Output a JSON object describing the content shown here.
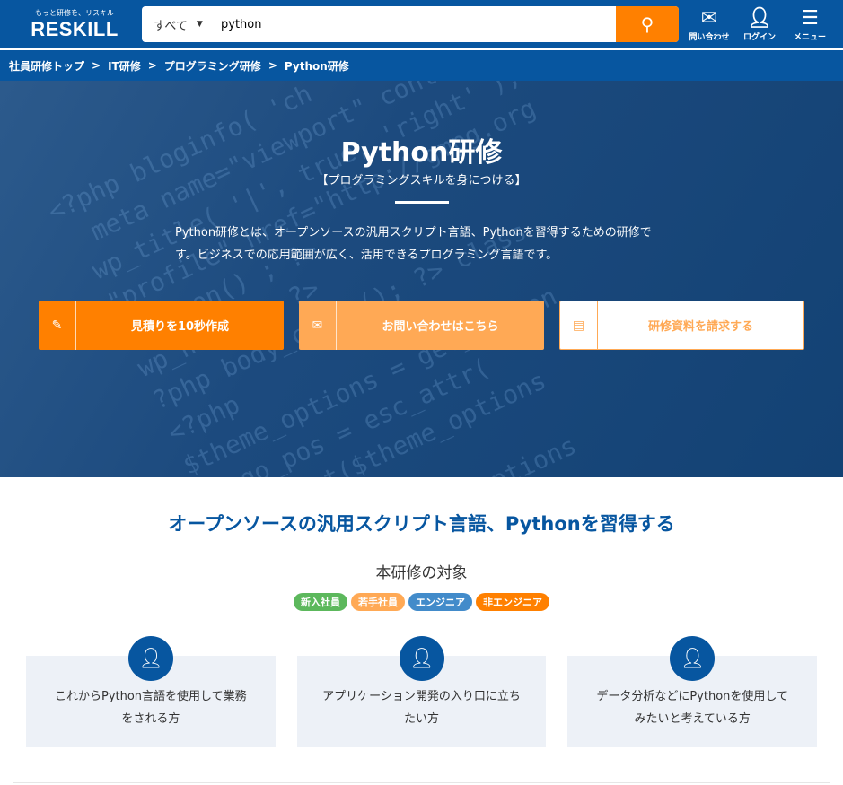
{
  "header": {
    "tagline": "もっと研修を、リスキル",
    "logo": "RESKILL",
    "search_category": "すべて",
    "search_value": "python",
    "icons": [
      {
        "icon": "mail-icon",
        "label": "問い合わせ"
      },
      {
        "icon": "user-icon",
        "label": "ログイン"
      },
      {
        "icon": "menu-icon",
        "label": "メニュー"
      }
    ]
  },
  "breadcrumb": [
    "社員研修トップ",
    "IT研修",
    "プログラミング研修",
    "Python研修"
  ],
  "hero": {
    "title": "Python研修",
    "subtitle": "【プログラミングスキルを身につける】",
    "description": "Python研修とは、オープンソースの汎用スクリプト言語、Pythonを習得するための研修です。ビジネスでの応用範囲が広く、活用できるプログラミング言語です。",
    "buttons": [
      "見積りを10秒作成",
      "お問い合わせはこちら",
      "研修資料を請求する"
    ]
  },
  "main": {
    "heading": "オープンソースの汎用スクリプト言語、Pythonを習得する",
    "target_title": "本研修の対象",
    "badges": [
      {
        "label": "新入社員",
        "color": "#5cb85c"
      },
      {
        "label": "若手社員",
        "color": "#ffa955"
      },
      {
        "label": "エンジニア",
        "color": "#428bca"
      },
      {
        "label": "非エンジニア",
        "color": "#ff8000"
      }
    ],
    "cards": [
      {
        "line1": "これからPython言語を使用して業務",
        "line2": "をされる方"
      },
      {
        "line1": "アプリケーション開発の入り口に立ち",
        "line2": "たい方"
      },
      {
        "line1": "データ分析などにPythonを使用して",
        "line2": "みたいと考えている方"
      }
    ]
  }
}
